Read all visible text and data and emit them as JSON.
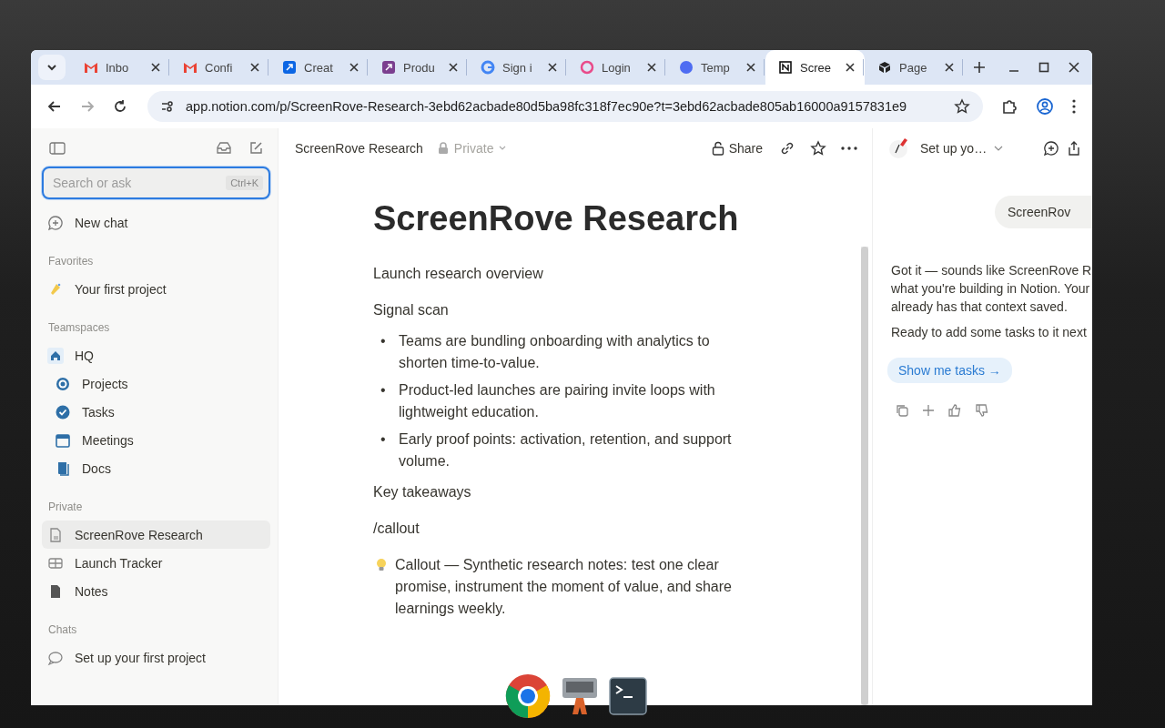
{
  "tabs": [
    {
      "label": "Inbo",
      "selected": false
    },
    {
      "label": "Confi",
      "selected": false
    },
    {
      "label": "Creat",
      "selected": false
    },
    {
      "label": "Produ",
      "selected": false
    },
    {
      "label": "Sign i",
      "selected": false
    },
    {
      "label": "Login",
      "selected": false
    },
    {
      "label": "Temp",
      "selected": false
    },
    {
      "label": "Scree",
      "selected": true
    },
    {
      "label": "Page",
      "selected": false
    }
  ],
  "address": "app.notion.com/p/ScreenRove-Research-3ebd62acbade80d5ba98fc318f7ec90e?t=3ebd62acbade805ab16000a9157831e9",
  "sidebar": {
    "search": {
      "placeholder": "Search or ask",
      "shortcut": "Ctrl+K"
    },
    "new_chat": "New chat",
    "sections": [
      {
        "title": "Favorites",
        "items": [
          {
            "label": "Your first project",
            "selected": false
          }
        ]
      },
      {
        "title": "Teamspaces",
        "items": [
          {
            "label": "HQ",
            "selected": false,
            "children": [
              {
                "label": "Projects",
                "selected": false
              },
              {
                "label": "Tasks",
                "selected": false
              },
              {
                "label": "Meetings",
                "selected": false
              },
              {
                "label": "Docs",
                "selected": false
              }
            ]
          }
        ]
      },
      {
        "title": "Private",
        "items": [
          {
            "label": "ScreenRove Research",
            "selected": true
          },
          {
            "label": "Launch Tracker",
            "selected": false
          },
          {
            "label": "Notes",
            "selected": false
          }
        ]
      },
      {
        "title": "Chats",
        "items": [
          {
            "label": "Set up your first project",
            "selected": false
          }
        ]
      }
    ]
  },
  "page": {
    "breadcrumb": "ScreenRove Research",
    "privacy": "Private",
    "share": "Share",
    "title": "ScreenRove Research",
    "blocks": [
      {
        "kind": "text",
        "text": "Launch research overview"
      },
      {
        "kind": "text",
        "text": "Signal scan"
      },
      {
        "kind": "bullets",
        "marker": "•",
        "items": [
          "Teams are bundling onboarding with analytics to shorten time-to-value.",
          "Product-led launches are pairing invite loops with lightweight education.",
          "Early proof points: activation, retention, and support volume."
        ]
      },
      {
        "kind": "text",
        "text": "Key takeaways"
      },
      {
        "kind": "text",
        "text": "/callout"
      },
      {
        "kind": "callout",
        "text": "Callout — Synthetic research notes: test one clear promise, instrument the moment of value, and share learnings weekly."
      }
    ]
  },
  "chat": {
    "title": "Set up yo…",
    "user_message": "ScreenRov",
    "reply_lines": [
      "Got it — sounds like ScreenRove R",
      "what you're building in Notion. Your",
      "already has that context saved."
    ],
    "question": "Ready to add some tasks to it next",
    "action": "Show me tasks →"
  }
}
